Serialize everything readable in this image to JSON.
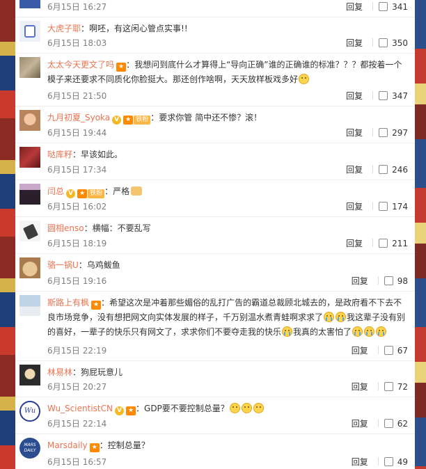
{
  "comments": [
    {
      "name": "",
      "text": "",
      "time": "6月15日 16:27",
      "likes": "341"
    },
    {
      "name": "大虎子耶",
      "text": "：啊呸，有这闲心管点实事!!",
      "time": "6月15日 18:03",
      "likes": "350"
    },
    {
      "name": "太太今天更文了吗",
      "text": "：我想问到底什么才算得上“导向正确”谁的正确谁的标准？？？都按着一个模子来还要求不同质化你脸挺大。那还创作啥啊，天天放样板戏多好",
      "time": "6月15日 21:50",
      "likes": "347"
    },
    {
      "name": "九月初夏_Syoka",
      "text": "：要求你管 简中还不惨？滚！",
      "time": "6月15日 19:44",
      "likes": "297"
    },
    {
      "name": "哒库籽",
      "text": "：早该如此。",
      "time": "6月15日 17:34",
      "likes": "246"
    },
    {
      "name": "闫总",
      "text": "：严格",
      "time": "6月15日 16:02",
      "likes": "174"
    },
    {
      "name": "圆相enso",
      "text": "：横幅：不要乱写",
      "time": "6月15日 18:19",
      "likes": "211"
    },
    {
      "name": "骆一锅U",
      "text": "：乌鸡鲅鱼",
      "time": "6月15日 19:16",
      "likes": "98"
    },
    {
      "name": "斯路上有枫",
      "text": "：希望这次是冲着那些媚俗的乱打广告的霸道总裁顾北城去的，是政府看不下去不良市场竞争，没有想把网文向实体发展的样子，千万别温水煮青蛙啊求求了",
      "text2": "我这辈子没有别的喜好，一辈子的快乐只有网文了，求求你们不要夺走我的快乐",
      "text3": "我真的太害怕了",
      "time": "6月15日 22:19",
      "likes": "67"
    },
    {
      "name": "林易林",
      "text": "：狗屁玩意儿",
      "time": "6月15日 20:27",
      "likes": "72"
    },
    {
      "name": "Wu_ScientistCN",
      "text": "：GDP要不要控制总量？",
      "time": "6月15日 22:14",
      "likes": "62"
    },
    {
      "name": "Marsdaily",
      "text": "：控制总量？",
      "time": "6月15日 16:57",
      "likes": "49"
    }
  ],
  "ui": {
    "reply_label": "回复",
    "badge_v": "V",
    "badge_fan": "铁粉",
    "avatar_text_wu": "Wu",
    "avatar_text_mars": "MARS DAILY"
  },
  "colors": {
    "accent": "#eb7350",
    "vip": "#f5b923"
  },
  "icons": {
    "like": "thumbs-up-icon",
    "rank": "fan-level-badge",
    "emoji": "emoji-icon"
  }
}
